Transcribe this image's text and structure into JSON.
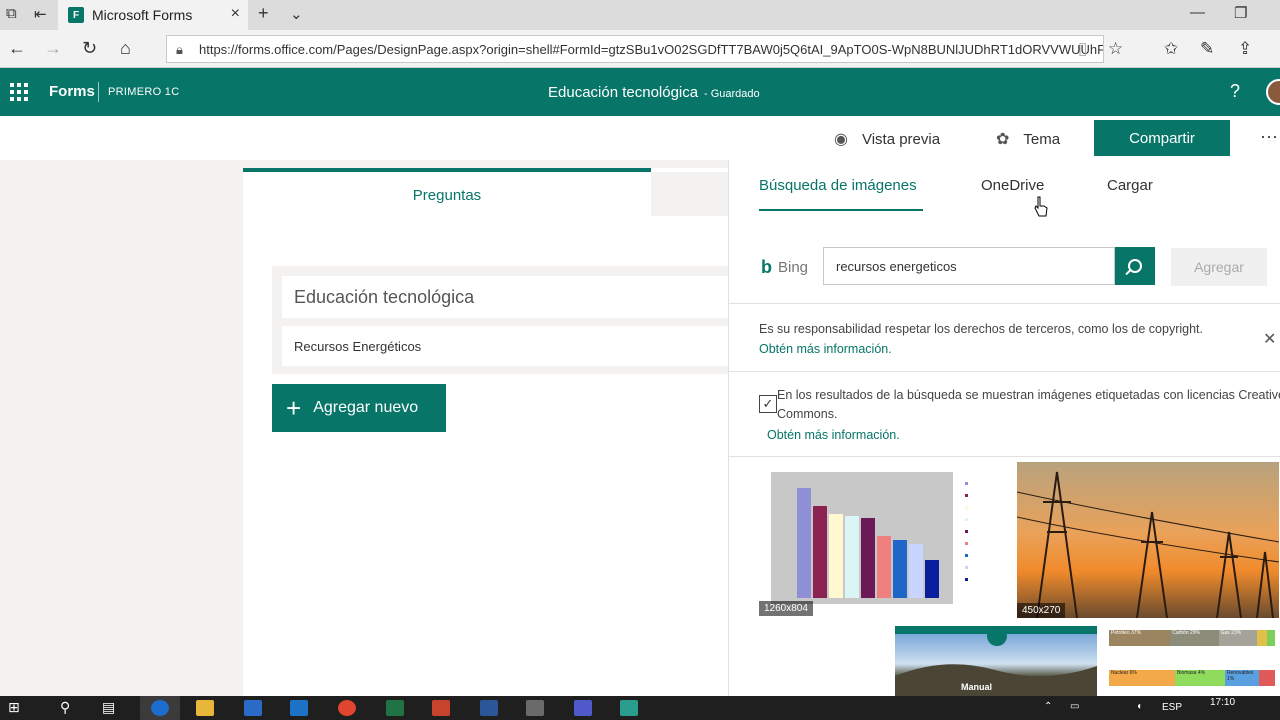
{
  "browser": {
    "tab_title": "Microsoft Forms",
    "url": "https://forms.office.com/Pages/DesignPage.aspx?origin=shell#FormId=gtzSBu1vO02SGDfTT7BAW0j5Q6tAI_9ApTO0S-WpN8BUNlJUDhRT1dORVVWUUhFODc"
  },
  "app": {
    "brand": "Forms",
    "org": "PRIMERO 1C",
    "form_title": "Educación tecnológica",
    "save_status": "- Guardado",
    "help": "?"
  },
  "commands": {
    "preview": "Vista previa",
    "theme": "Tema",
    "share": "Compartir",
    "more": "···"
  },
  "form": {
    "tab_questions": "Preguntas",
    "title": "Educación tecnológica",
    "description": "Recursos Energéticos",
    "add_new": "Agregar nuevo"
  },
  "image_panel": {
    "tabs": [
      "Búsqueda de imágenes",
      "OneDrive",
      "Cargar"
    ],
    "bing_label": "Bing",
    "search_value": "recursos energeticos",
    "add_button": "Agregar",
    "notice_text": "Es su responsabilidad respetar los derechos de terceros, como los de copyright.",
    "notice_link": "Obtén más información.",
    "cc_text": "En los resultados de la búsqueda se muestran imágenes etiquetadas con licencias Creative Commons.",
    "cc_link": "Obtén más información.",
    "cc_checked": true,
    "results": [
      {
        "dims": "1260x804"
      },
      {
        "dims": "450x270"
      },
      {
        "caption": "Manual"
      },
      {
        "labels": [
          "Petróleo 37%",
          "Carbón 29%",
          "Gas 23%",
          "Nuclear 6%",
          "Biomasa 4%",
          "Renovables 1%"
        ]
      }
    ]
  },
  "taskbar": {
    "language": "ESP",
    "time": "17:10"
  },
  "colors": {
    "accent": "#077568"
  }
}
